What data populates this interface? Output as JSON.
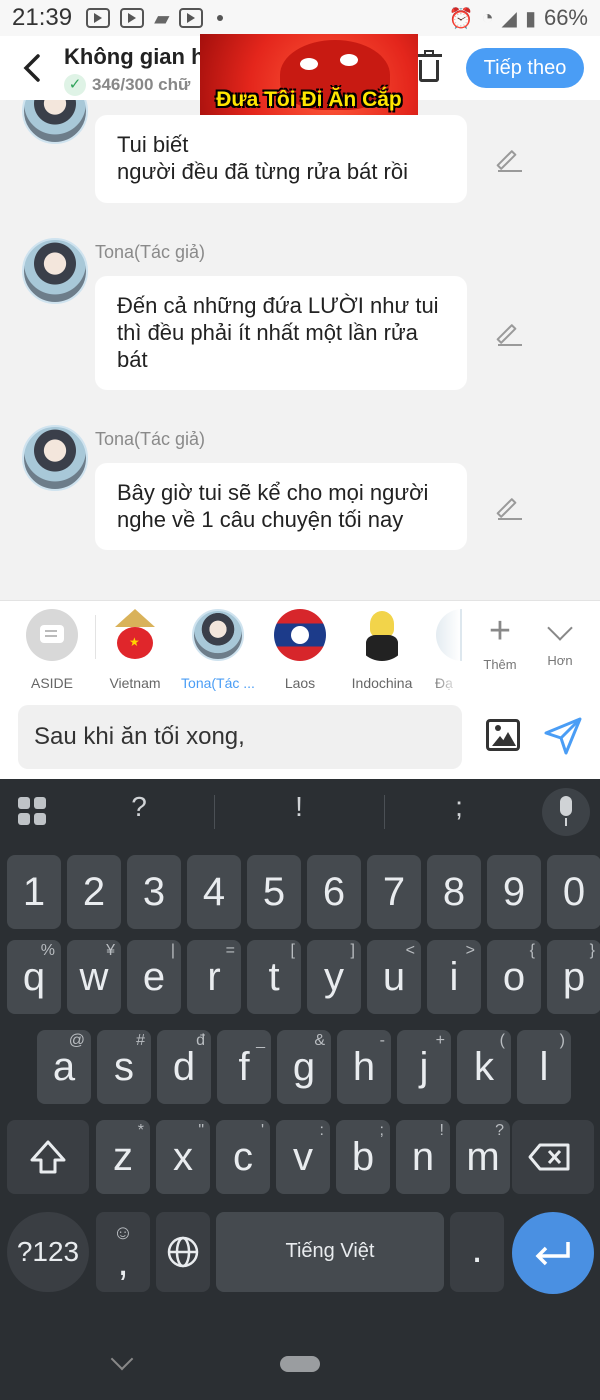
{
  "status_bar": {
    "time": "21:39",
    "battery": "66%"
  },
  "header": {
    "title": "Không gian h",
    "counter": "346/300 chữ",
    "next_label": "Tiếp theo"
  },
  "sticker": {
    "text": "Đưa Tôi Đi Ăn Cắp"
  },
  "messages": [
    {
      "sender": "",
      "text": "Tui biết ........................ người đều đã từng rửa bát rồi",
      "visible_text_line1": "Tui biết",
      "visible_text_line2": "người đều đã từng rửa bát rồi"
    },
    {
      "sender": "Tona(Tác giả)",
      "text": "Đến cả những đứa LƯỜI như tui thì đều phải ít nhất một lần rửa bát"
    },
    {
      "sender": "Tona(Tác giả)",
      "text": "Bây giờ tui sẽ kể cho mọi người nghe về 1 câu chuyện tối nay"
    }
  ],
  "characters": [
    {
      "label": "ASIDE"
    },
    {
      "label": "Vietnam"
    },
    {
      "label": "Tona(Tác ...",
      "active": true
    },
    {
      "label": "Laos"
    },
    {
      "label": "Indochina"
    },
    {
      "label": "Đạ"
    }
  ],
  "actions": {
    "add_label": "Thêm",
    "more_label": "Hơn"
  },
  "input": {
    "value": "Sau khi ăn tối xong,"
  },
  "keyboard": {
    "suggestions": [
      "?",
      "!",
      ";"
    ],
    "numbers": [
      "1",
      "2",
      "3",
      "4",
      "5",
      "6",
      "7",
      "8",
      "9",
      "0"
    ],
    "row1": [
      {
        "k": "q",
        "h": "%"
      },
      {
        "k": "w",
        "h": "¥"
      },
      {
        "k": "e",
        "h": "|"
      },
      {
        "k": "r",
        "h": "="
      },
      {
        "k": "t",
        "h": "["
      },
      {
        "k": "y",
        "h": "]"
      },
      {
        "k": "u",
        "h": "<"
      },
      {
        "k": "i",
        "h": ">"
      },
      {
        "k": "o",
        "h": "{"
      },
      {
        "k": "p",
        "h": "}"
      }
    ],
    "row2": [
      {
        "k": "a",
        "h": "@"
      },
      {
        "k": "s",
        "h": "#"
      },
      {
        "k": "d",
        "h": "đ"
      },
      {
        "k": "f",
        "h": "_"
      },
      {
        "k": "g",
        "h": "&"
      },
      {
        "k": "h",
        "h": "-"
      },
      {
        "k": "j",
        "h": "+"
      },
      {
        "k": "k",
        "h": "("
      },
      {
        "k": "l",
        "h": ")"
      }
    ],
    "row3": [
      {
        "k": "z",
        "h": "*"
      },
      {
        "k": "x",
        "h": "\""
      },
      {
        "k": "c",
        "h": "'"
      },
      {
        "k": "v",
        "h": ":"
      },
      {
        "k": "b",
        "h": ";"
      },
      {
        "k": "n",
        "h": "!"
      },
      {
        "k": "m",
        "h": "?"
      }
    ],
    "symbols_label": "?123",
    "comma_label": ",",
    "emoji_hint": "☺",
    "space_label": "Tiếng Việt",
    "period_label": "."
  }
}
